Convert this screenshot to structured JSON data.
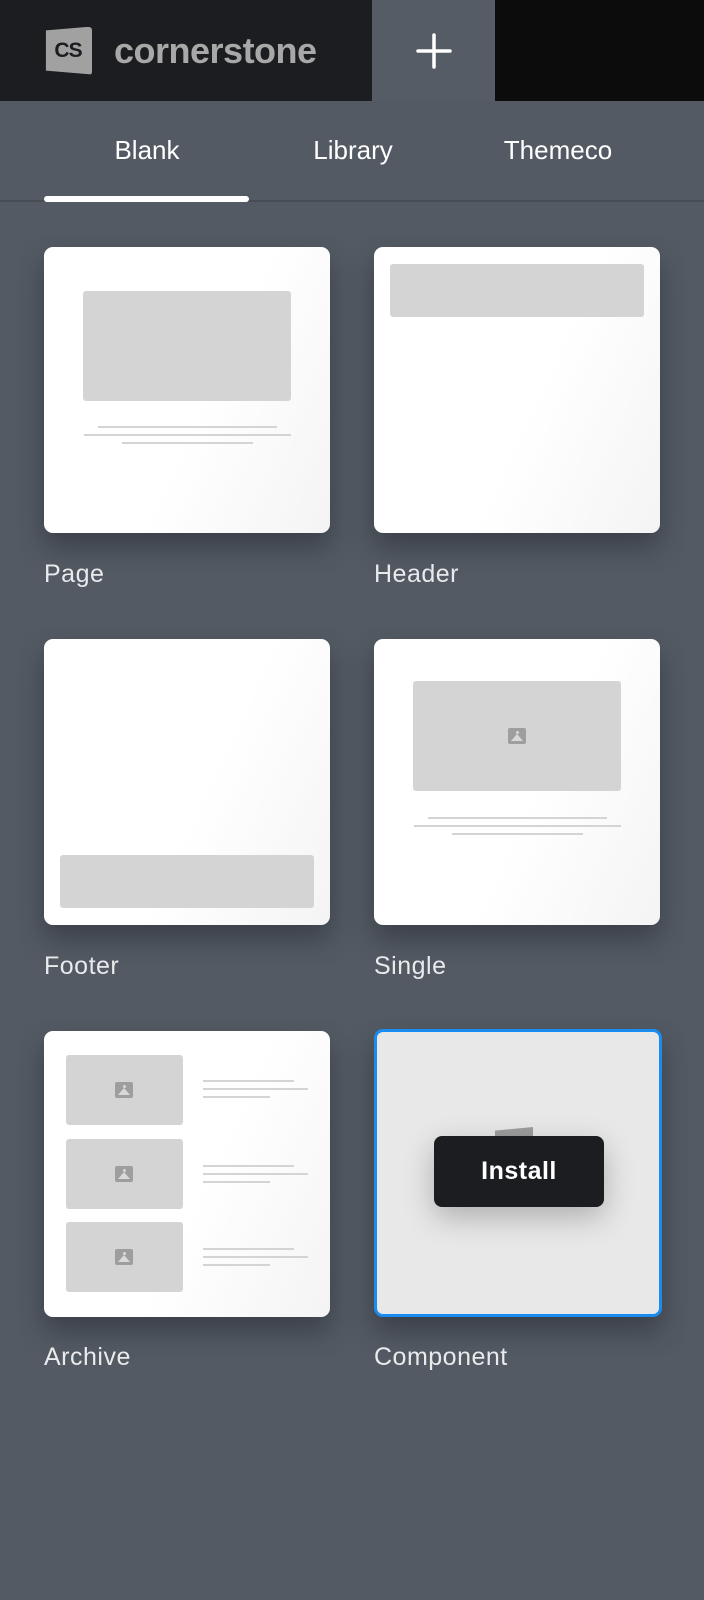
{
  "app": {
    "logo_mark": "CS",
    "name": "cornerstone",
    "add_icon": "plus-icon"
  },
  "tabs": [
    {
      "label": "Blank",
      "active": true
    },
    {
      "label": "Library",
      "active": false
    },
    {
      "label": "Themeco",
      "active": false
    }
  ],
  "templates": [
    {
      "label": "Page",
      "preview": "page-layout"
    },
    {
      "label": "Header",
      "preview": "header-layout"
    },
    {
      "label": "Footer",
      "preview": "footer-layout"
    },
    {
      "label": "Single",
      "preview": "single-layout"
    },
    {
      "label": "Archive",
      "preview": "archive-layout"
    },
    {
      "label": "Component",
      "preview": "component-layout",
      "selected": true,
      "action_label": "Install"
    }
  ],
  "colors": {
    "background": "#535a63",
    "topbar": "#1c1d20",
    "accent": "#1a8cf0"
  }
}
